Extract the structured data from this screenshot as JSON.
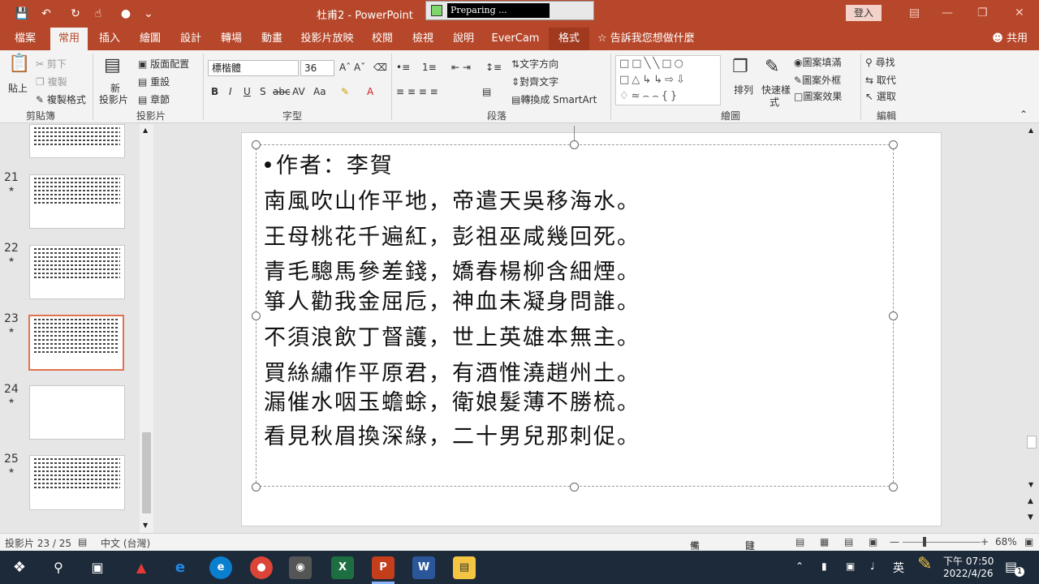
{
  "window": {
    "title": "杜甫2  -  PowerPoint",
    "preparing": "Preparing ...",
    "sign_in": "登入"
  },
  "tabs": [
    "檔案",
    "常用",
    "插入",
    "繪圖",
    "設計",
    "轉場",
    "動畫",
    "投影片放映",
    "校閱",
    "檢視",
    "說明",
    "EverCam",
    "格式"
  ],
  "tell_me": "告訴我您想做什麼",
  "share": "共用",
  "ribbon": {
    "clipboard": {
      "paste": "貼上",
      "cut": "剪下",
      "copy": "複製",
      "format_painter": "複製格式",
      "label": "剪貼簿"
    },
    "slides": {
      "new_slide": "新",
      "new_slide2": "投影片",
      "layout": "版面配置",
      "reset": "重設",
      "section": "章節",
      "label": "投影片"
    },
    "font": {
      "name": "標楷體",
      "size": "36",
      "label": "字型"
    },
    "paragraph": {
      "text_direction": "文字方向",
      "align_text": "對齊文字",
      "smartart": "轉換成 SmartArt",
      "label": "段落"
    },
    "drawing": {
      "arrange": "排列",
      "quick_styles": "快速樣",
      "quick_styles2": "式",
      "fill": "圖案填滿",
      "outline": "圖案外框",
      "effects": "圖案效果",
      "label": "繪圖"
    },
    "editing": {
      "find": "尋找",
      "replace": "取代",
      "select": "選取",
      "label": "編輯"
    }
  },
  "thumbnails": [
    {
      "num": "21",
      "lines": 7
    },
    {
      "num": "22",
      "lines": 8
    },
    {
      "num": "23",
      "lines": 9
    },
    {
      "num": "24",
      "lines": 0
    },
    {
      "num": "25",
      "lines": 9
    }
  ],
  "slide": {
    "bullet": "作者：李賀",
    "lines": [
      "南風吹山作平地，帝遣天吳移海水。",
      "王母桃花千遍紅，彭祖巫咸幾回死。",
      "青毛驄馬參差錢，嬌春楊柳含細煙。",
      "箏人勸我金屈卮，神血未凝身問誰。",
      "不須浪飲丁督護，世上英雄本無主。",
      "買絲繡作平原君，有酒惟澆趙州土。",
      "漏催水咽玉蟾蜍，衛娘髮薄不勝梳。",
      "看見秋眉換深綠，二十男兒那刺促。"
    ]
  },
  "status": {
    "slide_count": "投影片 23 / 25",
    "language": "中文 (台灣)",
    "notes": "備忘稿",
    "comments": "註解",
    "zoom": "68%"
  },
  "taskbar": {
    "time": "下午 07:50",
    "date": "2022/4/26",
    "ime": "英",
    "notif": "1"
  }
}
